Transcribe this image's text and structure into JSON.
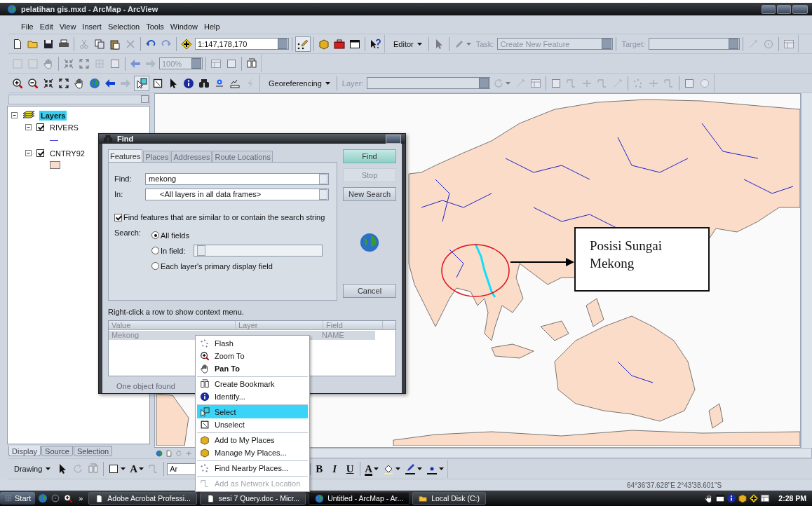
{
  "window": {
    "title": "pelatihan gis.mxd - ArcMap - ArcView"
  },
  "menu": [
    "File",
    "Edit",
    "View",
    "Insert",
    "Selection",
    "Tools",
    "Window",
    "Help"
  ],
  "standard_toolbar": [
    {
      "kind": "tool",
      "disabled": false
    },
    {
      "kind": "tool",
      "disabled": false
    },
    {
      "kind": "tool",
      "disabled": false
    },
    {
      "kind": "tool",
      "disabled": false
    },
    {
      "kind": "sep"
    },
    {
      "kind": "tool",
      "disabled": true
    },
    {
      "kind": "tool",
      "disabled": false
    },
    {
      "kind": "tool",
      "disabled": false
    },
    {
      "kind": "tool",
      "disabled": true
    },
    {
      "kind": "sep"
    },
    {
      "kind": "tool",
      "disabled": false
    },
    {
      "kind": "tool",
      "disabled": true
    },
    {
      "kind": "sep"
    },
    {
      "kind": "tool",
      "disabled": false
    },
    {
      "kind": "field",
      "value": "1:147,178,170",
      "combo": true,
      "disabled": false
    },
    {
      "kind": "sep"
    },
    {
      "kind": "tool",
      "disabled": false,
      "pressed": true
    },
    {
      "kind": "sep"
    },
    {
      "kind": "tool",
      "disabled": false
    },
    {
      "kind": "tool",
      "disabled": false
    },
    {
      "kind": "tool",
      "disabled": false
    },
    {
      "kind": "sep"
    },
    {
      "kind": "tool",
      "disabled": false
    }
  ],
  "editor_toolbar": [
    {
      "kind": "menu",
      "label": "Editor"
    },
    {
      "kind": "sep"
    },
    {
      "kind": "tool",
      "disabled": true
    },
    {
      "kind": "sep"
    },
    {
      "kind": "tool",
      "disabled": true,
      "dropdown": true
    },
    {
      "kind": "label",
      "text": "Task:",
      "disabled": true
    },
    {
      "kind": "field",
      "value": "Create New Feature",
      "combo": true,
      "disabled": true
    },
    {
      "kind": "sep"
    },
    {
      "kind": "label",
      "text": "Target:",
      "disabled": true
    },
    {
      "kind": "field",
      "combo": true,
      "disabled": true
    },
    {
      "kind": "sep"
    },
    {
      "kind": "tool",
      "disabled": true
    },
    {
      "kind": "tool",
      "disabled": true
    },
    {
      "kind": "sep"
    },
    {
      "kind": "tool",
      "disabled": true
    }
  ],
  "layout_toolbar": [
    {
      "kind": "tool",
      "disabled": true
    },
    {
      "kind": "tool",
      "disabled": true
    },
    {
      "kind": "tool",
      "disabled": true
    },
    {
      "kind": "sep"
    },
    {
      "kind": "tool",
      "disabled": true
    },
    {
      "kind": "tool",
      "disabled": true
    },
    {
      "kind": "tool",
      "disabled": true
    },
    {
      "kind": "tool",
      "disabled": true
    },
    {
      "kind": "sep"
    },
    {
      "kind": "tool",
      "disabled": true
    },
    {
      "kind": "tool",
      "disabled": true
    },
    {
      "kind": "field",
      "value": "100%",
      "combo": true,
      "disabled": true
    },
    {
      "kind": "sep"
    },
    {
      "kind": "tool",
      "disabled": true
    },
    {
      "kind": "tool",
      "disabled": true
    },
    {
      "kind": "sep"
    },
    {
      "kind": "tool",
      "disabled": false
    }
  ],
  "tools_toolbar": [
    {
      "kind": "tool",
      "disabled": false
    },
    {
      "kind": "tool",
      "disabled": false
    },
    {
      "kind": "tool",
      "disabled": false
    },
    {
      "kind": "tool",
      "disabled": false
    },
    {
      "kind": "tool",
      "disabled": false
    },
    {
      "kind": "tool",
      "disabled": false
    },
    {
      "kind": "tool",
      "disabled": false
    },
    {
      "kind": "tool",
      "disabled": true
    },
    {
      "kind": "tool",
      "disabled": false,
      "pressed": true
    },
    {
      "kind": "tool",
      "disabled": false
    },
    {
      "kind": "tool",
      "disabled": false
    },
    {
      "kind": "tool",
      "disabled": false
    },
    {
      "kind": "tool",
      "disabled": false
    },
    {
      "kind": "tool",
      "disabled": false
    },
    {
      "kind": "tool",
      "disabled": false
    },
    {
      "kind": "tool",
      "disabled": true
    }
  ],
  "georef_toolbar": [
    {
      "kind": "menu",
      "label": "Georeferencing"
    },
    {
      "kind": "sep"
    },
    {
      "kind": "label",
      "text": "Layer:",
      "disabled": true
    },
    {
      "kind": "field",
      "combo": true,
      "disabled": true
    },
    {
      "kind": "tool",
      "disabled": true,
      "dropdown": true
    },
    {
      "kind": "tool",
      "disabled": true
    },
    {
      "kind": "tool",
      "disabled": true
    },
    {
      "kind": "sep"
    },
    {
      "kind": "tool",
      "disabled": true
    },
    {
      "kind": "tool",
      "disabled": true
    },
    {
      "kind": "tool",
      "disabled": true
    },
    {
      "kind": "tool",
      "disabled": true
    },
    {
      "kind": "tool",
      "disabled": true
    },
    {
      "kind": "sep"
    },
    {
      "kind": "tool",
      "disabled": true
    },
    {
      "kind": "tool",
      "disabled": true
    },
    {
      "kind": "tool",
      "disabled": true
    },
    {
      "kind": "sep"
    },
    {
      "kind": "tool",
      "disabled": true
    },
    {
      "kind": "tool",
      "disabled": true
    }
  ],
  "toc": {
    "tree": [
      {
        "label": "Layers",
        "selected": true,
        "expanded": true,
        "children": [
          {
            "label": "RIVERS",
            "checked": true,
            "expanded": true,
            "selected": false,
            "symbol": {
              "kind": "line",
              "color": "#4a4ad8"
            }
          },
          {
            "label": "CNTRY92",
            "checked": true,
            "expanded": true,
            "selected": false,
            "symbol": {
              "kind": "fill",
              "color": "#fbdcc8"
            }
          }
        ]
      }
    ],
    "tabs": [
      {
        "label": "Display",
        "selected": true
      },
      {
        "label": "Source",
        "selected": false
      },
      {
        "label": "Selection",
        "selected": false
      }
    ]
  },
  "map": {
    "callout": "Posisi Sungai Mekong"
  },
  "find_dialog": {
    "title": "Find",
    "tabs": [
      {
        "label": "Features",
        "selected": true
      },
      {
        "label": "Places",
        "selected": false
      },
      {
        "label": "Addresses",
        "selected": false
      },
      {
        "label": "Route Locations",
        "selected": false
      }
    ],
    "find_label": "Find:",
    "find_value": "mekong",
    "in_label": "In:",
    "in_value": "<All layers in all data frames>",
    "similar": {
      "label": "Find features that are similar to or contain the search string",
      "checked": true
    },
    "search_label": "Search:",
    "search_options": [
      {
        "label": "All fields",
        "selected": true
      },
      {
        "label": "In field:",
        "selected": false
      },
      {
        "label": "Each layer's primary display field",
        "selected": false
      }
    ],
    "in_field_disabled": true,
    "buttons": [
      {
        "label": "Find",
        "default": true,
        "disabled": false
      },
      {
        "label": "Stop",
        "default": false,
        "disabled": true
      },
      {
        "label": "New Search",
        "default": false,
        "disabled": false
      },
      {
        "label": "Cancel",
        "default": false,
        "disabled": false
      }
    ],
    "hint": "Right-click a row to show context menu.",
    "columns": [
      "Value",
      "Layer",
      "Field"
    ],
    "rows": [
      {
        "value": "Mekong",
        "field": "NAME",
        "selected": true
      }
    ],
    "status": "One object found"
  },
  "context_menu": [
    {
      "label": "Flash",
      "default": false,
      "selected": false,
      "disabled": false,
      "separator_before": false
    },
    {
      "label": "Zoom To",
      "default": false,
      "selected": false,
      "disabled": false,
      "separator_before": false
    },
    {
      "label": "Pan To",
      "default": true,
      "selected": false,
      "disabled": false,
      "separator_before": false
    },
    {
      "label": "Create Bookmark",
      "default": false,
      "selected": false,
      "disabled": false,
      "separator_before": true
    },
    {
      "label": "Identify...",
      "default": false,
      "selected": false,
      "disabled": false,
      "separator_before": false
    },
    {
      "label": "Select",
      "default": false,
      "selected": true,
      "disabled": false,
      "separator_before": true
    },
    {
      "label": "Unselect",
      "default": false,
      "selected": false,
      "disabled": false,
      "separator_before": false
    },
    {
      "label": "Add to My Places",
      "default": false,
      "selected": false,
      "disabled": false,
      "separator_before": true
    },
    {
      "label": "Manage My Places...",
      "default": false,
      "selected": false,
      "disabled": false,
      "separator_before": false
    },
    {
      "label": "Find Nearby Places...",
      "default": false,
      "selected": false,
      "disabled": false,
      "separator_before": true
    },
    {
      "label": "Add as Network Location",
      "default": false,
      "selected": false,
      "disabled": true,
      "separator_before": true
    }
  ],
  "drawing_toolbar": [
    {
      "kind": "menu",
      "label": "Drawing"
    },
    {
      "kind": "tool",
      "disabled": false
    },
    {
      "kind": "tool",
      "disabled": true
    },
    {
      "kind": "tool",
      "disabled": true
    },
    {
      "kind": "sep"
    },
    {
      "kind": "tool",
      "disabled": false,
      "dropdown": true
    },
    {
      "kind": "tool",
      "disabled": false,
      "dropdown": true,
      "glyph": "A"
    },
    {
      "kind": "tool",
      "disabled": true
    },
    {
      "kind": "sep"
    },
    {
      "kind": "field",
      "value": "Ar",
      "combo": true,
      "disabled": false
    },
    {
      "kind": "tool",
      "disabled": false,
      "glyph": "B"
    },
    {
      "kind": "tool",
      "disabled": false,
      "glyph": "I"
    },
    {
      "kind": "tool",
      "disabled": false,
      "glyph": "U"
    },
    {
      "kind": "sep"
    },
    {
      "kind": "tool",
      "disabled": false,
      "dropdown": true,
      "glyph": "A"
    },
    {
      "kind": "tool",
      "disabled": false,
      "dropdown": true
    },
    {
      "kind": "tool",
      "disabled": false,
      "dropdown": true
    },
    {
      "kind": "tool",
      "disabled": false,
      "dropdown": true
    }
  ],
  "status_bar": {
    "coordinates": "64°36'37.628\"E  2°43'38.601\"S"
  },
  "taskbar": {
    "start": "Start",
    "more": "»",
    "tasks": [
      {
        "label": "Adobe Acrobat Professi...",
        "selected": false
      },
      {
        "label": "sesi 7 Query.doc - Micr...",
        "selected": false
      },
      {
        "label": "Untitled - ArcMap - Ar...",
        "selected": true
      },
      {
        "label": "Local Disk (C:)",
        "selected": false
      }
    ],
    "clock": "2:28 PM"
  }
}
